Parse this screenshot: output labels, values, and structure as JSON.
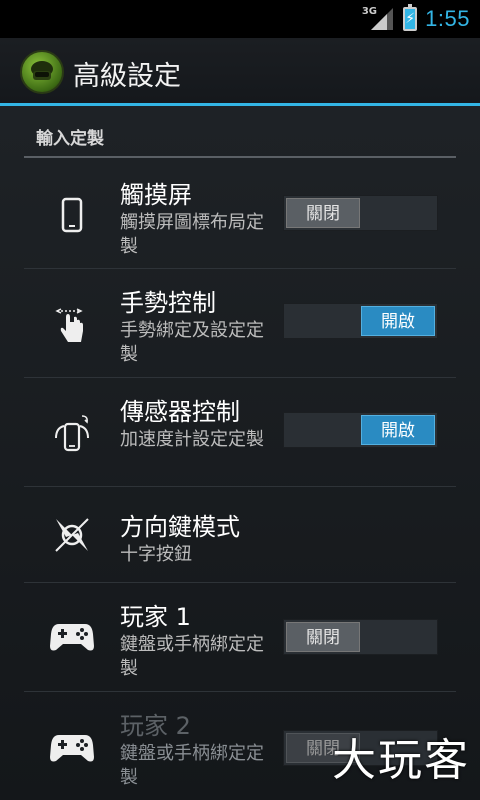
{
  "status_bar": {
    "network": "3G",
    "time": "1:55"
  },
  "action_bar": {
    "title": "高級設定",
    "app_icon": "soldier-helmet-icon"
  },
  "section": {
    "header": "輸入定製"
  },
  "items": [
    {
      "icon": "phone-icon",
      "title": "觸摸屏",
      "summary": "觸摸屏圖標布局定製",
      "toggle": "關閉",
      "state": "off"
    },
    {
      "icon": "hand-gesture-icon",
      "title": "手勢控制",
      "summary": "手勢綁定及設定定製",
      "toggle": "開啟",
      "state": "on"
    },
    {
      "icon": "rotate-phone-icon",
      "title": "傳感器控制",
      "summary": "加速度計設定定製",
      "toggle": "開啟",
      "state": "on"
    },
    {
      "icon": "compass-dpad-icon",
      "title": "方向鍵模式",
      "summary": "十字按鈕"
    },
    {
      "icon": "gamepad-icon",
      "title": "玩家 1",
      "summary": "鍵盤或手柄綁定定製",
      "toggle": "關閉",
      "state": "off"
    },
    {
      "icon": "gamepad-icon",
      "title": "玩家 2",
      "summary": "鍵盤或手柄綁定定製",
      "toggle": "關閉",
      "state": "off",
      "disabled": true
    }
  ],
  "watermark": "大玩客",
  "colors": {
    "accent": "#33b5e5",
    "toggle_on": "#2a8bc2"
  }
}
